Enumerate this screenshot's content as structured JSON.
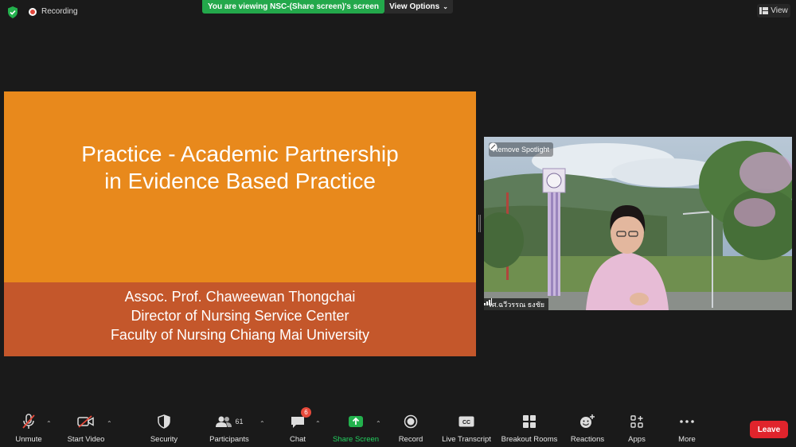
{
  "topbar": {
    "recording_label": "Recording",
    "viewing_banner": "You are viewing NSC-(Share screen)'s screen",
    "view_options_label": "View Options",
    "view_label": "View"
  },
  "slide": {
    "title_lines": [
      "Practice - Academic Partnership",
      "in Evidence Based Practice"
    ],
    "subtitle_lines": [
      "Assoc. Prof. Chaweewan Thongchai",
      "Director of Nursing Service Center",
      "Faculty of Nursing Chiang Mai University"
    ]
  },
  "video": {
    "spotlight_label": "Remove Spotlight",
    "participant_name": "รศ.ฉวีวรรณ ธงชัย"
  },
  "toolbar": {
    "unmute": "Unmute",
    "start_video": "Start Video",
    "security": "Security",
    "participants": "Participants",
    "participant_count": "61",
    "chat": "Chat",
    "chat_badge": "6",
    "share_screen": "Share Screen",
    "record": "Record",
    "live_transcript": "Live Transcript",
    "breakout_rooms": "Breakout Rooms",
    "reactions": "Reactions",
    "apps": "Apps",
    "more": "More",
    "leave": "Leave"
  },
  "colors": {
    "slide_orange": "#e8891c",
    "slide_rust": "#c4572b",
    "share_green": "#23a84b",
    "leave_red": "#e0242c"
  }
}
